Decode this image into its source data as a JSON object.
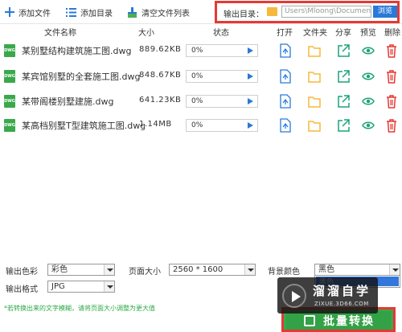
{
  "toolbar": {
    "add_file": "添加文件",
    "add_dir": "添加目录",
    "clear_list": "清空文件列表",
    "output_dir_label": "输出目录：",
    "output_path": "Users\\Mloong\\Documents",
    "browse": "浏览"
  },
  "header": {
    "name": "文件名称",
    "size": "大小",
    "status": "状态",
    "open": "打开",
    "folder": "文件夹",
    "share": "分享",
    "preview": "预览",
    "delete": "删除"
  },
  "files": [
    {
      "type": "DWG",
      "name": "某别墅结构建筑施工图.dwg",
      "size": "889.62KB",
      "progress": "0%"
    },
    {
      "type": "DWG",
      "name": "某宾馆别墅的全套施工图.dwg",
      "size": "848.67KB",
      "progress": "0%"
    },
    {
      "type": "DWG",
      "name": "某带阁楼别墅建施.dwg",
      "size": "641.23KB",
      "progress": "0%"
    },
    {
      "type": "DWG",
      "name": "某高档别墅T型建筑施工图.dwg",
      "size": "1.14MB",
      "progress": "0%"
    }
  ],
  "settings": {
    "color_label": "输出色彩",
    "color_value": "彩色",
    "page_size_label": "页面大小",
    "page_size_value": "2560 * 1600",
    "bg_color_label": "背景颜色",
    "bg_color_value": "黑色",
    "format_label": "输出格式",
    "format_value": "JPG",
    "dropdown_option": "黑色"
  },
  "hint": "*若转换出来的文字模糊，请将页面大小调整为更大值",
  "convert_button": "批量转换",
  "watermark": {
    "title": "溜溜自学",
    "subtitle": "ZIXUE.3D66.COM"
  },
  "colors": {
    "accent_blue": "#2979d9",
    "highlight_red": "#e53935",
    "convert_green": "#33a146",
    "folder_yellow": "#f6b93b",
    "delete_red": "#e53935",
    "preview_teal": "#1aa37a"
  }
}
